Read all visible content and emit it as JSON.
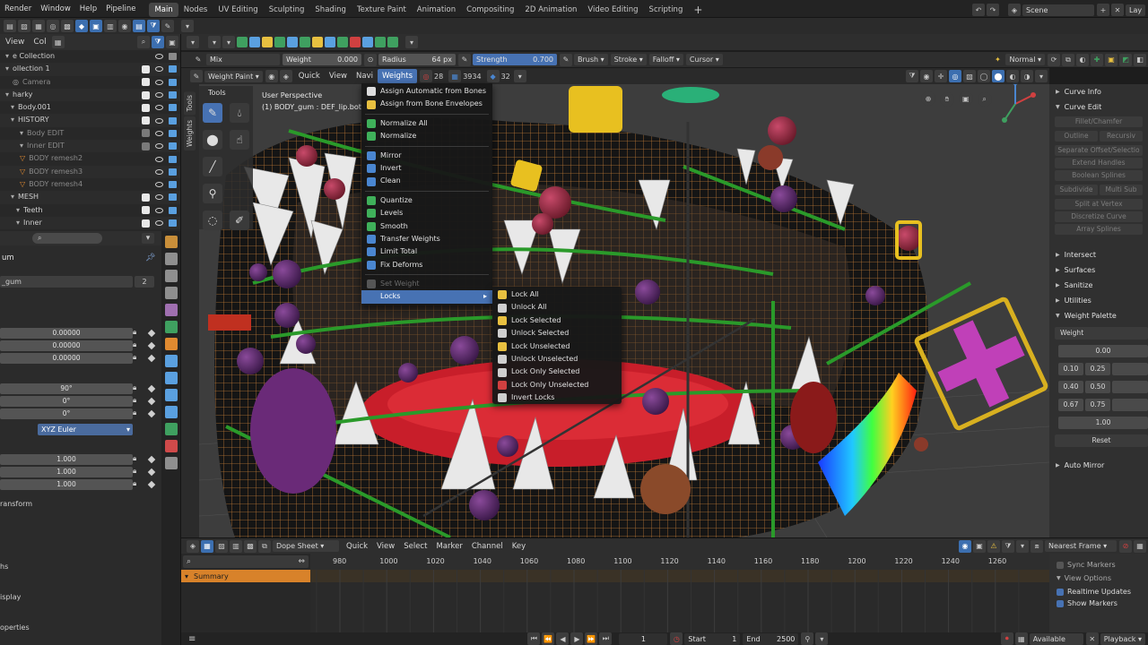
{
  "topbar": {
    "menus": [
      "Render",
      "Window",
      "Help",
      "Pipeline"
    ],
    "workspaces": [
      "Main",
      "Nodes",
      "UV Editing",
      "Sculpting",
      "Shading",
      "Texture Paint",
      "Animation",
      "Compositing",
      "2D Animation",
      "Video Editing",
      "Scripting"
    ],
    "add_tab": "+",
    "scene": "Scene",
    "view_layer": "Lay"
  },
  "row2": {
    "view": "View",
    "col": "Col"
  },
  "outliner": {
    "items": [
      {
        "label": "e Collection",
        "checked": null
      },
      {
        "label": "ollection 1",
        "checked": true
      },
      {
        "label": "Camera",
        "checked": true,
        "dim": true
      },
      {
        "label": "harky",
        "checked": true
      },
      {
        "label": "Body.001",
        "checked": true
      },
      {
        "label": "HISTORY",
        "checked": true
      },
      {
        "label": "Body EDIT",
        "checked": false,
        "dim": true
      },
      {
        "label": "Inner EDIT",
        "checked": false,
        "dim": true
      },
      {
        "label": "BODY remesh2",
        "checked": null,
        "dim": true
      },
      {
        "label": "BODY remesh3",
        "checked": null,
        "dim": true
      },
      {
        "label": "BODY remesh4",
        "checked": null,
        "dim": true
      },
      {
        "label": "MESH",
        "checked": true
      },
      {
        "label": "Teeth",
        "checked": true
      },
      {
        "label": "Inner",
        "checked": true
      }
    ]
  },
  "props": {
    "title": "um",
    "mesh_name": "_gum",
    "mesh_users": "2",
    "location": [
      "0.00000",
      "0.00000",
      "0.00000"
    ],
    "rotation": [
      "90°",
      "0°",
      "0°"
    ],
    "rotation_mode": "XYZ Euler",
    "scale": [
      "1.000",
      "1.000",
      "1.000"
    ],
    "section_transform": "ransform",
    "section_s": "hs",
    "section_display": "isplay",
    "section_properties": "operties"
  },
  "toolsettings": {
    "blend": "Mix",
    "weight_label": "Weight",
    "weight_value": "0.000",
    "radius_label": "Radius",
    "radius_value": "64 px",
    "strength_label": "Strength",
    "strength_value": "0.700",
    "brush": "Brush",
    "stroke": "Stroke",
    "falloff": "Falloff",
    "cursor": "Cursor",
    "shading_mode": "Normal"
  },
  "vp_header": {
    "mode": "Weight Paint",
    "menus": [
      "Quick",
      "View",
      "Navi"
    ],
    "active_menu": "Weights",
    "num1": "28",
    "num2": "3934",
    "num3": "32"
  },
  "viewport": {
    "persp": "User Perspective",
    "object": "(1) BODY_gum : DEF_lip.bot.L",
    "tools_tab": "Tools",
    "weights_tab": "Weights",
    "tools_header": "Tools"
  },
  "weights_menu": {
    "items": [
      {
        "label": "Assign Automatic from Bones",
        "icon": "bone-icon",
        "color": "#dddddd"
      },
      {
        "label": "Assign from Bone Envelopes",
        "icon": "envelope-icon",
        "color": "#e8c040"
      },
      {
        "sep": true
      },
      {
        "label": "Normalize All",
        "icon": "normalize-all-icon",
        "color": "#3fb05a"
      },
      {
        "label": "Normalize",
        "icon": "normalize-icon",
        "color": "#3fb05a"
      },
      {
        "sep": true
      },
      {
        "label": "Mirror",
        "icon": "mirror-icon",
        "color": "#4a86d0"
      },
      {
        "label": "Invert",
        "icon": "invert-icon",
        "color": "#4a86d0"
      },
      {
        "label": "Clean",
        "icon": "clean-icon",
        "color": "#4a86d0"
      },
      {
        "sep": true
      },
      {
        "label": "Quantize",
        "icon": "quantize-icon",
        "color": "#3fb05a"
      },
      {
        "label": "Levels",
        "icon": "levels-icon",
        "color": "#3fb05a"
      },
      {
        "label": "Smooth",
        "icon": "smooth-icon",
        "color": "#3fb05a"
      },
      {
        "label": "Transfer Weights",
        "icon": "transfer-icon",
        "color": "#4a86d0"
      },
      {
        "label": "Limit Total",
        "icon": "limit-icon",
        "color": "#4a86d0"
      },
      {
        "label": "Fix Deforms",
        "icon": "fix-icon",
        "color": "#4a86d0"
      },
      {
        "sep": true
      },
      {
        "label": "Set Weight",
        "icon": "set-weight-icon",
        "color": "#555555",
        "disabled": true
      },
      {
        "label": "Locks",
        "icon": "",
        "color": "",
        "active": true,
        "submenu": true
      }
    ]
  },
  "locks_menu": {
    "items": [
      {
        "label": "Lock All",
        "icon": "lock-icon",
        "color": "#e8c040"
      },
      {
        "label": "Unlock All",
        "icon": "unlock-icon",
        "color": "#cfcfcf"
      },
      {
        "label": "Lock Selected",
        "icon": "lock-icon",
        "color": "#e8c040"
      },
      {
        "label": "Unlock Selected",
        "icon": "unlock-icon",
        "color": "#cfcfcf"
      },
      {
        "label": "Lock Unselected",
        "icon": "lock-icon",
        "color": "#e8c040"
      },
      {
        "label": "Unlock Unselected",
        "icon": "unlock-icon",
        "color": "#cfcfcf"
      },
      {
        "label": "Lock Only Selected",
        "icon": "cursor-icon",
        "color": "#cfcfcf"
      },
      {
        "label": "Lock Only Unselected",
        "icon": "cursor-icon",
        "color": "#d04040"
      },
      {
        "label": "Invert Locks",
        "icon": "invert-locks-icon",
        "color": "#cfcfcf"
      }
    ]
  },
  "rpanel": {
    "curve_info": "Curve Info",
    "curve_edit": "Curve Edit",
    "buttons": [
      "Fillet/Chamfer",
      "Outline",
      "Recursiv",
      "Separate Offset/Selectio",
      "Extend Handles",
      "Boolean Splines",
      "Subdivide",
      "Multi Sub",
      "Split at Vertex",
      "Discretize Curve",
      "Array Splines"
    ],
    "sections": [
      "Intersect",
      "Surfaces",
      "Sanitize",
      "Utilities",
      "Weight Palette"
    ],
    "palette_label": "Weight",
    "palette": [
      "0.00",
      "0.10",
      "0.25",
      "0.40",
      "0.50",
      "0.67",
      "0.75",
      "1.00"
    ],
    "reset": "Reset",
    "auto_mirror": "Auto Mirror"
  },
  "timeline": {
    "editor": "Dope Sheet",
    "menus": [
      "Quick",
      "View",
      "Select",
      "Marker",
      "Channel",
      "Key"
    ],
    "snap": "Nearest Frame",
    "summary": "Summary",
    "frames": [
      "980",
      "1000",
      "1020",
      "1040",
      "1060",
      "1080",
      "1100",
      "1120",
      "1140",
      "1160",
      "1180",
      "1200",
      "1220",
      "1240",
      "1260"
    ],
    "sync_markers": "Sync Markers",
    "view_options": "View Options",
    "realtime": "Realtime Updates",
    "show_markers": "Show Markers"
  },
  "statusbar": {
    "current_frame": "1",
    "start_label": "Start",
    "start": "1",
    "end_label": "End",
    "end": "2500",
    "available": "Available",
    "playback": "Playback"
  },
  "colors": {
    "accent": "#4772b3",
    "menu_bg": "#181818",
    "viewport_bg": "#3d3d3d"
  }
}
